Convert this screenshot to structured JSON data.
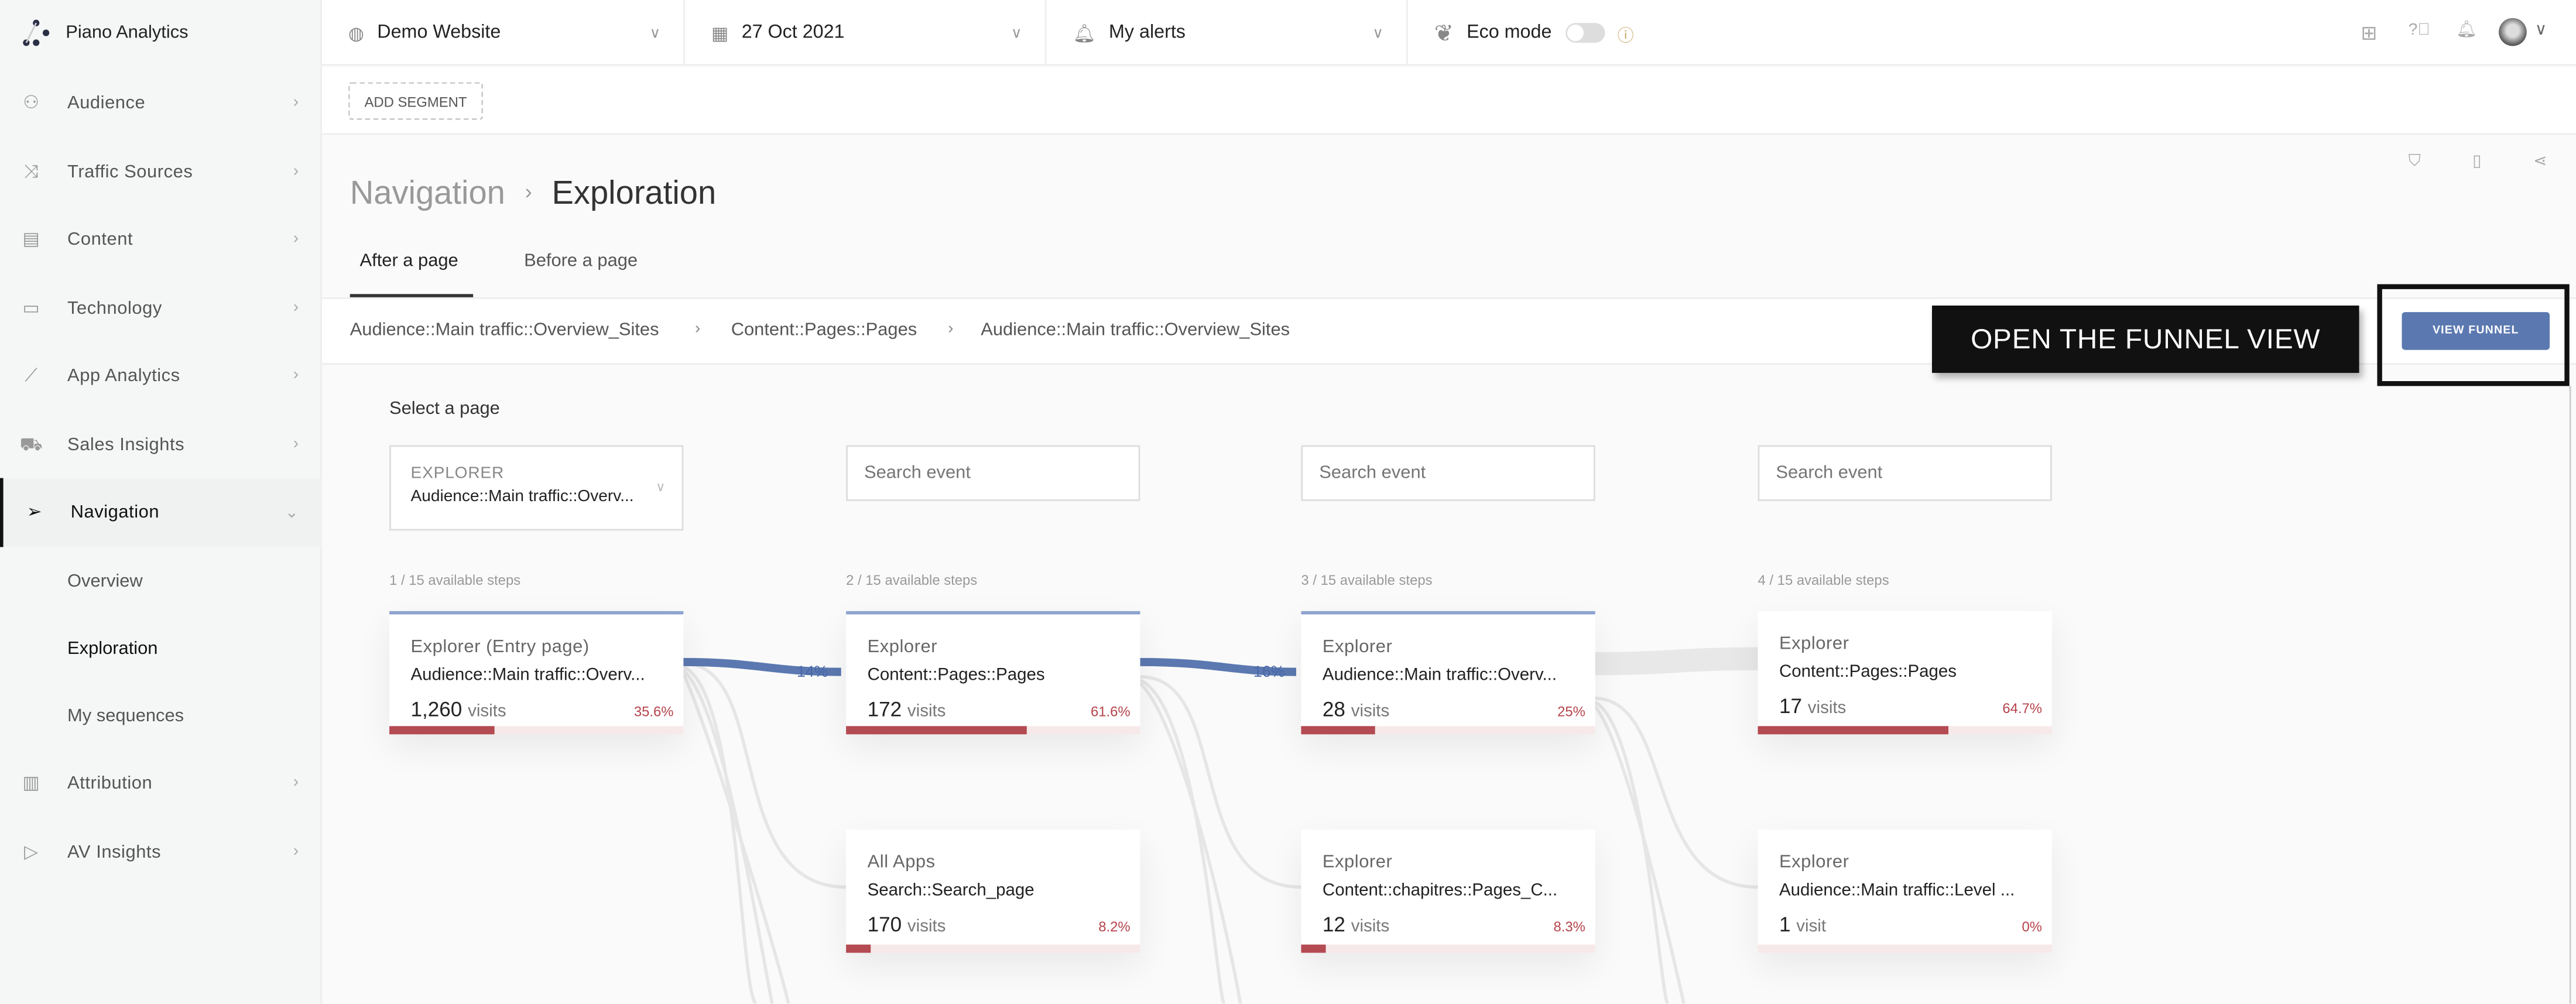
{
  "app": {
    "name": "Piano Analytics"
  },
  "sidebar": {
    "items": [
      {
        "label": "Audience",
        "icon": "users-icon"
      },
      {
        "label": "Traffic Sources",
        "icon": "shuffle-icon"
      },
      {
        "label": "Content",
        "icon": "document-icon"
      },
      {
        "label": "Technology",
        "icon": "monitor-icon"
      },
      {
        "label": "App Analytics",
        "icon": "line-chart-icon"
      },
      {
        "label": "Sales Insights",
        "icon": "cart-icon"
      },
      {
        "label": "Navigation",
        "icon": "cursor-icon"
      },
      {
        "label": "Attribution",
        "icon": "bar-chart-icon"
      },
      {
        "label": "AV Insights",
        "icon": "play-icon"
      }
    ],
    "subitems": [
      "Overview",
      "Exploration",
      "My sequences"
    ]
  },
  "topbar": {
    "site": "Demo Website",
    "date": "27 Oct 2021",
    "alerts": "My alerts",
    "eco": "Eco mode"
  },
  "segment": {
    "add": "ADD SEGMENT"
  },
  "page": {
    "section": "Navigation",
    "title": "Exploration",
    "tabs": [
      "After a page",
      "Before a page"
    ]
  },
  "breadcrumb": [
    "Audience::Main traffic::Overview_Sites",
    "Content::Pages::Pages",
    "Audience::Main traffic::Overview_Sites"
  ],
  "annotation": "OPEN THE FUNNEL VIEW",
  "view_funnel": "VIEW FUNNEL",
  "explorer": {
    "select_label": "Select a page",
    "type": "EXPLORER",
    "value": "Audience::Main traffic::Overv...",
    "search_placeholder": "Search event"
  },
  "steps": [
    "1 / 15 available steps",
    "2 / 15 available steps",
    "3 / 15 available steps",
    "4 / 15 available steps"
  ],
  "flows": [
    "14%",
    "16%"
  ],
  "cards": [
    {
      "cat": "Explorer (Entry page)",
      "name": "Audience::Main traffic::Overv...",
      "count": "1,260",
      "unit": "visits",
      "pct": "35.6%",
      "fill": 35.6
    },
    {
      "cat": "Explorer",
      "name": "Content::Pages::Pages",
      "count": "172",
      "unit": "visits",
      "pct": "61.6%",
      "fill": 61.6
    },
    {
      "cat": "Explorer",
      "name": "Audience::Main traffic::Overv...",
      "count": "28",
      "unit": "visits",
      "pct": "25%",
      "fill": 25
    },
    {
      "cat": "Explorer",
      "name": "Content::Pages::Pages",
      "count": "17",
      "unit": "visits",
      "pct": "64.7%",
      "fill": 64.7
    },
    {
      "cat": "All Apps",
      "name": "Search::Search_page",
      "count": "170",
      "unit": "visits",
      "pct": "8.2%",
      "fill": 8.2
    },
    {
      "cat": "Explorer",
      "name": "Content::chapitres::Pages_C...",
      "count": "12",
      "unit": "visits",
      "pct": "8.3%",
      "fill": 8.3
    },
    {
      "cat": "Explorer",
      "name": "Audience::Main traffic::Level ...",
      "count": "1",
      "unit": "visit",
      "pct": "0%",
      "fill": 0
    }
  ],
  "colors": {
    "accent": "#5b78b0",
    "bar": "#b44a52"
  }
}
